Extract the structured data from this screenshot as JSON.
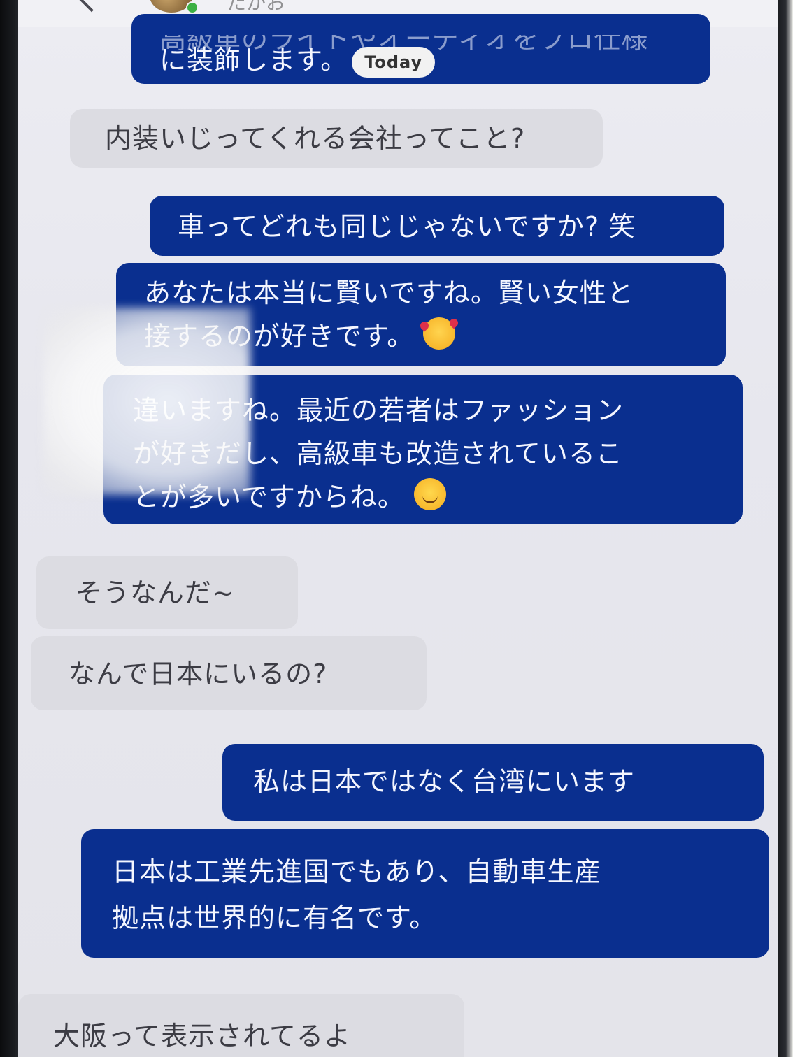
{
  "header": {
    "contact_name": "たかお"
  },
  "messages": [
    {
      "id": "m0",
      "side": "out",
      "text_top": "高級車のライトやオーディオをプロ仕様",
      "text": "に装飾します。",
      "badge": "Today"
    },
    {
      "id": "m1",
      "side": "in",
      "text": "内装いじってくれる会社ってこと?"
    },
    {
      "id": "m2",
      "side": "out",
      "text": "車ってどれも同じじゃないですか? 笑"
    },
    {
      "id": "m3",
      "side": "out",
      "line1": "あなたは本当に賢いですね。賢い女性と",
      "line2": "接するのが好きです。",
      "emoji": "smiling-face-with-hearts"
    },
    {
      "id": "m4",
      "side": "out",
      "line1": "違いますね。最近の若者はファッション",
      "line2": "が好きだし、高級車も改造されているこ",
      "line3": "とが多いですからね。",
      "emoji": "smiling-face"
    },
    {
      "id": "m5",
      "side": "in",
      "text": "そうなんだ~"
    },
    {
      "id": "m6",
      "side": "in",
      "text": "なんで日本にいるの?"
    },
    {
      "id": "m7",
      "side": "out",
      "text": "私は日本ではなく台湾にいます"
    },
    {
      "id": "m8",
      "side": "out",
      "line1": "日本は工業先進国でもあり、自動車生産",
      "line2": "拠点は世界的に有名です。"
    },
    {
      "id": "m9",
      "side": "in",
      "text": "大阪って表示されてるよ"
    }
  ],
  "colors": {
    "outgoing_bubble": "#0a2f8f",
    "incoming_bubble": "#dcdce2",
    "screen_bg": "#e8e8ee"
  }
}
